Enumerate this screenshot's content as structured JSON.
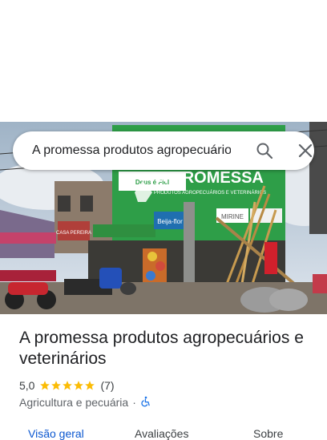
{
  "search": {
    "value": "A promessa produtos agropecuários e veterinários"
  },
  "photo": {
    "sign_main": "A PROMESSA",
    "sign_sub": "PRODUTOS AGROPECUÁRIOS E VETERINÁRIOS",
    "sign_left_shop": "Deus é Fiel",
    "sign_beija_flor": "Beija-flor",
    "sign_brand": "MIRINE",
    "sign_red_shop": "CASA PEREIRA"
  },
  "place": {
    "name": "A promessa produtos agropecuários e veterinários",
    "rating": "5,0",
    "stars": 5,
    "review_count": "(7)",
    "category": "Agricultura e pecuária",
    "separator": "·"
  },
  "tabs": [
    {
      "label": "Visão geral",
      "active": true
    },
    {
      "label": "Avaliações",
      "active": false
    },
    {
      "label": "Sobre",
      "active": false
    }
  ],
  "colors": {
    "accent": "#0b57d0",
    "star": "#fbbc04",
    "sign_green": "#2e9e48"
  },
  "icons": {
    "search": "search-icon",
    "clear": "close-icon",
    "accessibility": "wheelchair-icon"
  }
}
